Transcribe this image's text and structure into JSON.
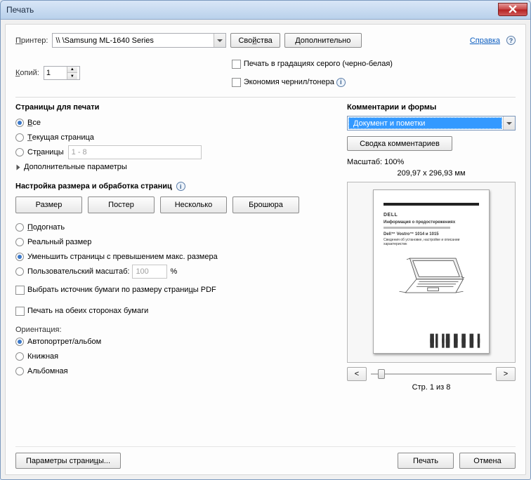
{
  "window": {
    "title": "Печать"
  },
  "header": {
    "printer_label": "Принтер:",
    "printer_value": "\\\\        \\Samsung ML-1640 Series",
    "properties_btn": "Свойства",
    "advanced_btn": "Дополнительно",
    "help_link": "Справка"
  },
  "copies": {
    "label": "Копий:",
    "value": "1",
    "grayscale": "Печать в градациях серого (черно-белая)",
    "eco": "Экономия чернил/тонера"
  },
  "pages": {
    "title": "Страницы для печати",
    "all": "Все",
    "current": "Текущая страница",
    "range_label": "Страницы",
    "range_value": "1 - 8",
    "more": "Дополнительные параметры"
  },
  "sizing": {
    "title": "Настройка размера и обработка страниц",
    "btns": [
      "Размер",
      "Постер",
      "Несколько",
      "Брошюра"
    ],
    "fit": "Подогнать",
    "actual": "Реальный размер",
    "shrink": "Уменьшить страницы с превышением макс. размера",
    "custom": "Пользовательский масштаб:",
    "custom_value": "100",
    "percent": "%",
    "source": "Выбрать источник бумаги по размеру страницы PDF",
    "duplex": "Печать на обеих сторонах бумаги"
  },
  "orient": {
    "title": "Ориентация:",
    "auto": "Автопортрет/альбом",
    "portrait": "Книжная",
    "landscape": "Альбомная"
  },
  "comments": {
    "title": "Комментарии и формы",
    "value": "Документ и пометки",
    "summary_btn": "Сводка комментариев"
  },
  "preview": {
    "scale": "Масштаб: 100%",
    "dims": "209,97 x 296,93 мм",
    "pager": "Стр. 1 из 8",
    "prev": "<",
    "next": ">",
    "page_logo": "DELL",
    "page_heading": "Информация о предостережениях",
    "page_model": "Dell™ Vostro™ 1014 и 1015",
    "page_sub": "Сведения об установке, настройке и описании характеристик"
  },
  "footer": {
    "page_setup": "Параметры страницы...",
    "print": "Печать",
    "cancel": "Отмена"
  }
}
